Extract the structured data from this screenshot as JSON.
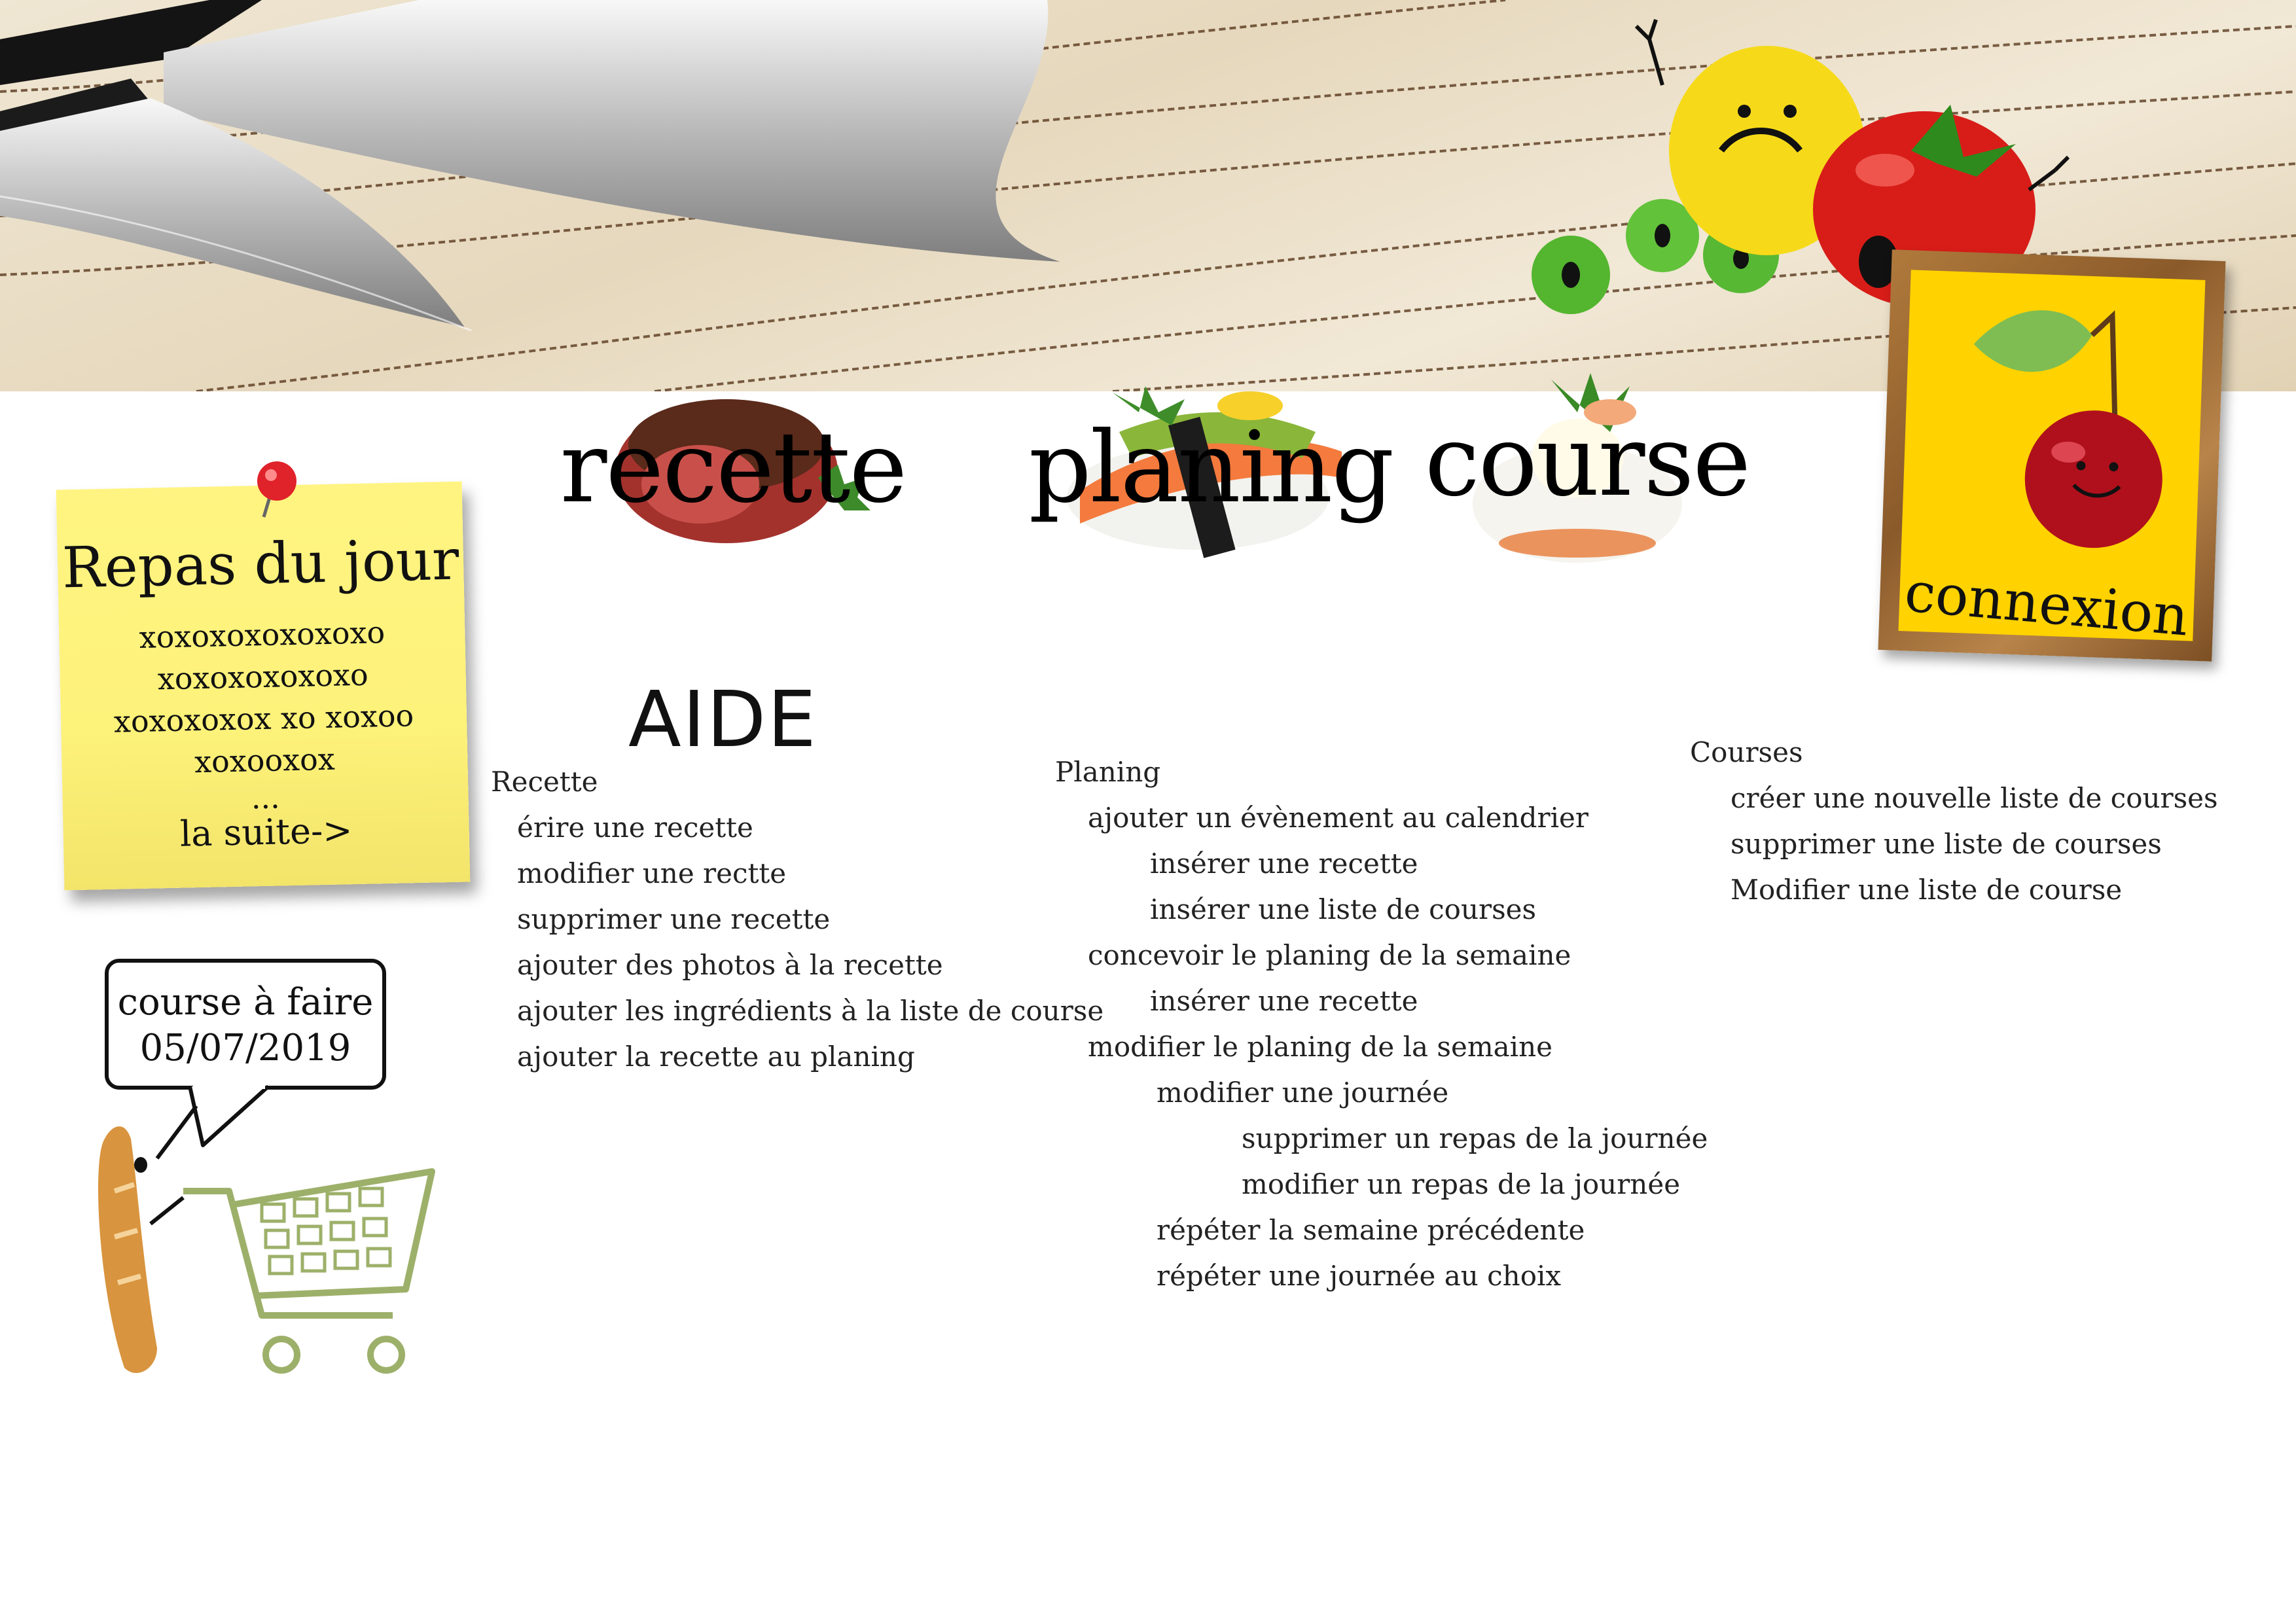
{
  "nav": {
    "recette": "recette",
    "planing": "planing",
    "course": "course",
    "connexion": "connexion"
  },
  "sticky": {
    "title": "Repas du jour",
    "lines": [
      "xoxoxoxoxoxoxo",
      "xoxoxoxoxoxo",
      "xoxoxoxox xo xoxoo",
      "xoxooxox"
    ],
    "dots": "...",
    "more": "la suite->"
  },
  "shopping": {
    "label": "course à faire",
    "date": "05/07/2019"
  },
  "aide": {
    "title": "AIDE",
    "columns": [
      {
        "title": "Recette",
        "items": [
          "érire une recette",
          "modifier une rectte",
          "supprimer une recette",
          "ajouter des photos à la recette",
          "ajouter les ingrédients à la liste de course",
          "ajouter la recette au planing"
        ]
      },
      {
        "title": "Planing",
        "items": [
          "ajouter un évènement au calendrier",
          "insérer une recette",
          "insérer une liste de courses",
          "concevoir le planing de la semaine",
          "insérer une recette",
          "modifier le planing de la semaine",
          "modifier une journée",
          "supprimer un repas de la journée",
          "modifier un repas de la journée",
          "répéter la semaine précédente",
          "répéter une journée au choix"
        ]
      },
      {
        "title": "Courses",
        "items": [
          "créer une nouvelle liste de courses",
          "supprimer une liste de courses",
          "Modifier une liste de course"
        ]
      }
    ]
  },
  "colors": {
    "sticky": "#fdf27a",
    "frame_inner": "#ffd200",
    "banner": "#e8dcc4"
  }
}
